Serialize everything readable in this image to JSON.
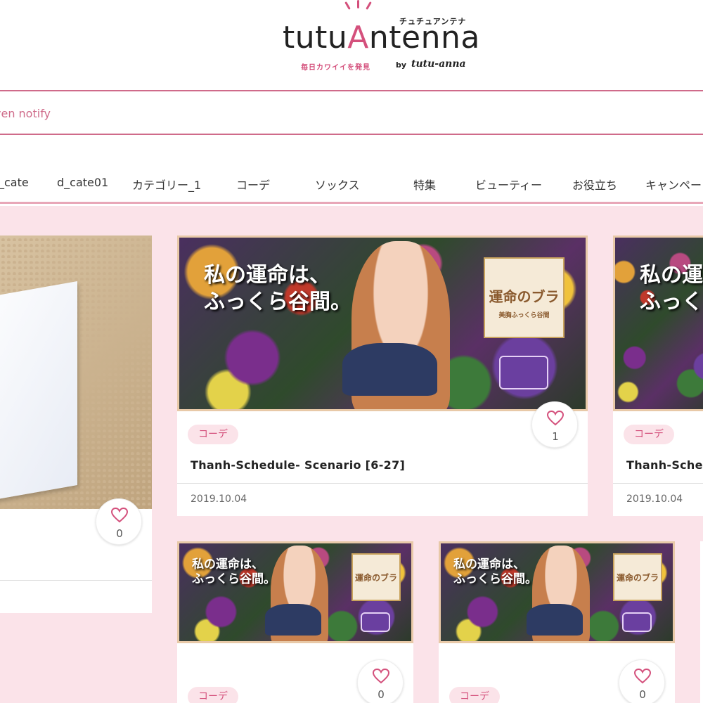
{
  "header": {
    "logo_prefix": "tutu",
    "logo_a": "A",
    "logo_suffix": "ntenna",
    "logo_kana": "チュチュアンテナ",
    "tagline": "毎日カワイイを発見",
    "by": "by",
    "brand": "tutu-anna"
  },
  "notify": {
    "text": "ven notify"
  },
  "nav": {
    "items": [
      {
        "label": "_cate"
      },
      {
        "label": "d_cate01"
      },
      {
        "label": "カテゴリー_1"
      },
      {
        "label": "コーデ"
      },
      {
        "label": "ソックス"
      },
      {
        "label": "特集"
      },
      {
        "label": "ビューティー"
      },
      {
        "label": "お役立ち"
      },
      {
        "label": "キャンペー"
      }
    ]
  },
  "banner": {
    "headline_line1": "私の運命は、",
    "headline_line2": "ふっくら谷間。",
    "product_label": "運命のブラ",
    "product_sub": "美胸ふっくら谷間"
  },
  "cards": [
    {
      "like_count": "0"
    },
    {
      "tag": "コーデ",
      "title": "Thanh-Schedule- Scenario [6-27]",
      "date": "2019.10.04",
      "like_count": "1"
    },
    {
      "tag": "コーデ",
      "title": "Thanh-Schedu",
      "date": "2019.10.04"
    },
    {
      "tag": "コーデ",
      "like_count": "0"
    },
    {
      "tag": "コーデ",
      "like_count": "0"
    }
  ],
  "colors": {
    "accent": "#d4507c",
    "bg_pink": "#fbe3e9",
    "border_pink": "#cf6b8a"
  },
  "icons": {
    "like": "heart-icon"
  }
}
